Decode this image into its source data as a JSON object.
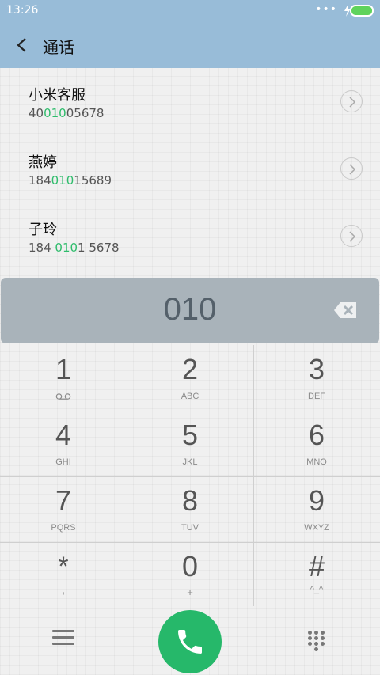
{
  "status_bar": {
    "time": "13:26",
    "dots": "•••"
  },
  "header": {
    "title": "通话"
  },
  "contacts": [
    {
      "name": "小米客服",
      "number_pre": "40",
      "number_match": "010",
      "number_post": "05678"
    },
    {
      "name": "燕婷",
      "number_pre": "184",
      "number_match": "010",
      "number_post": "15689"
    },
    {
      "name": "子玲",
      "number_pre": "184 ",
      "number_match": "010",
      "number_post": "1 5678"
    }
  ],
  "dial_input": {
    "value": "010"
  },
  "keypad": [
    {
      "num": "1",
      "sub": ""
    },
    {
      "num": "2",
      "sub": "ABC"
    },
    {
      "num": "3",
      "sub": "DEF"
    },
    {
      "num": "4",
      "sub": "GHI"
    },
    {
      "num": "5",
      "sub": "JKL"
    },
    {
      "num": "6",
      "sub": "MNO"
    },
    {
      "num": "7",
      "sub": "PQRS"
    },
    {
      "num": "8",
      "sub": "TUV"
    },
    {
      "num": "9",
      "sub": "WXYZ"
    },
    {
      "num": "*",
      "sub": ","
    },
    {
      "num": "0",
      "sub": "+"
    },
    {
      "num": "#",
      "sub": "^_^"
    }
  ],
  "colors": {
    "header": "#98bcd8",
    "accent_green": "#26b86a",
    "match_green": "#2ebc6b",
    "input_bar": "#a9b3ba"
  }
}
